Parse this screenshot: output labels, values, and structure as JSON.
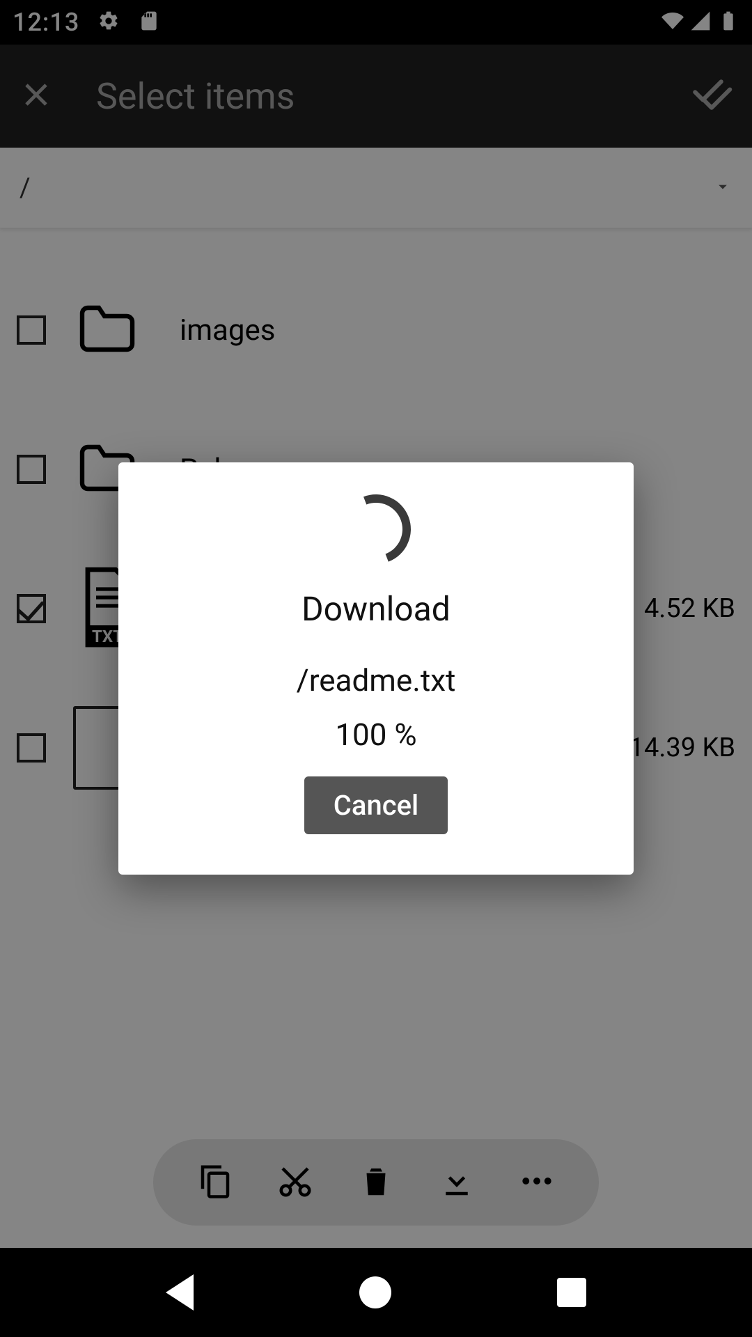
{
  "status": {
    "time": "12:13",
    "gear_icon": "gear",
    "sd_icon": "sd-card",
    "wifi_icon": "wifi",
    "signal_icon": "cell-signal",
    "battery_icon": "battery-full"
  },
  "app_bar": {
    "title": "Select items",
    "close_icon": "close",
    "select_all_icon": "select-all"
  },
  "path_bar": {
    "path": "/",
    "caret_icon": "chevron-down"
  },
  "files": [
    {
      "name": "images",
      "kind": "folder",
      "size": "",
      "checked": false
    },
    {
      "name": "Pub",
      "kind": "folder",
      "size": "",
      "checked": false
    },
    {
      "name": "readme.txt",
      "kind": "txt",
      "size": "4.52 KB",
      "checked": true
    },
    {
      "name": "",
      "kind": "file",
      "size": "14.39 KB",
      "checked": false
    }
  ],
  "actions": {
    "copy_icon": "copy",
    "cut_icon": "cut",
    "delete_icon": "delete",
    "download_icon": "download",
    "more_icon": "more"
  },
  "dialog": {
    "title": "Download",
    "file": "/readme.txt",
    "percent": "100 %",
    "cancel_label": "Cancel"
  },
  "colors": {
    "dialog_button_bg": "#555555",
    "app_bar_bg": "#212121"
  }
}
